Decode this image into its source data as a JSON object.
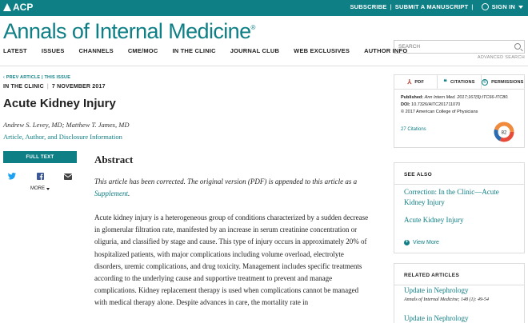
{
  "topbar": {
    "logo": "ACP",
    "subscribe": "SUBSCRIBE",
    "submit": "SUBMIT A MANUSCRIPT",
    "signin": "SIGN IN",
    "color": "#0e7f85"
  },
  "masthead": {
    "title": "Annals of Internal Medicine",
    "mark": "®"
  },
  "search": {
    "placeholder": "SEARCH",
    "advanced": "ADVANCED SEARCH"
  },
  "nav": [
    "LATEST",
    "ISSUES",
    "CHANNELS",
    "CME/MOC",
    "IN THE CLINIC",
    "JOURNAL CLUB",
    "WEB EXCLUSIVES",
    "AUTHOR INFO"
  ],
  "breadcrumb": {
    "prev": "‹ PREV ARTICLE",
    "this_issue": "THIS ISSUE"
  },
  "article": {
    "section": "IN THE CLINIC",
    "date": "7 NOVEMBER 2017",
    "title": "Acute Kidney Injury",
    "authors": "Andrew S. Levey, MD; Matthew T. James, MD",
    "disclosure": "Article, Author, and Disclosure Information"
  },
  "sidebar_left": {
    "full_text": "FULL TEXT",
    "more": "MORE"
  },
  "abstract": {
    "heading": "Abstract",
    "note_line1": "This article has been corrected. The original version (PDF) is appended to this article as a",
    "note_link": "Supplement",
    "body": "Acute kidney injury is a heterogeneous group of conditions characterized by a sudden decrease in glomerular filtration rate, manifested by an increase in serum creatinine concentration or oliguria, and classified by stage and cause. This type of injury occurs in approximately 20% of hospitalized patients, with major complications including volume overload, electrolyte disorders, uremic complications, and drug toxicity. Management includes specific treatments according to the underlying cause and supportive treatment to prevent and manage complications. Kidney replacement therapy is used when complications cannot be managed with medical therapy alone. Despite advances in care, the mortality rate in"
  },
  "tools": {
    "pdf": "PDF",
    "citations": "CITATIONS",
    "permissions": "PERMISSIONS",
    "published_label": "Published:",
    "published_value": "Ann Intern Med. 2017;167(9):ITC66-ITC80.",
    "doi_label": "DOI:",
    "doi_value": "10.7326/AITC201711070",
    "copyright": "© 2017 American College of Physicians",
    "citations_count": "27 Citations",
    "altmetric_score": "82"
  },
  "see_also": {
    "heading": "SEE ALSO",
    "links": [
      "Correction: In the Clinic—Acute Kidney Injury",
      "Acute Kidney Injury"
    ],
    "view_more": "View More"
  },
  "related": {
    "heading": "RELATED ARTICLES",
    "items": [
      {
        "title": "Update in Nephrology",
        "source": "Annals of Internal Medicine; 148 (1): 49-54"
      },
      {
        "title": "Update in Nephrology"
      }
    ]
  }
}
